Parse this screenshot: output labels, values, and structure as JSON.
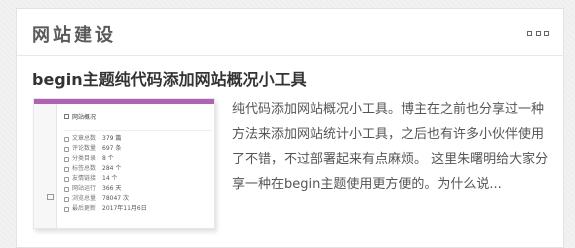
{
  "section": {
    "title": "网站建设",
    "more_icon": "more-dots-icon"
  },
  "post": {
    "title": "begin主题纯代码添加网站概况小工具",
    "excerpt": "纯代码添加网站概况小工具。博主在之前也分享过一种方法来添加网站统计小工具，之后也有许多小伙伴使用了不错，不过部署起来有点麻烦。 这里朱曙明给大家分享一种在begin主题使用更方便的。为什么说..."
  },
  "thumbnail": {
    "accent_color": "#b062b5",
    "panel_title": "网站概况",
    "rows": [
      {
        "icon": "doc-icon",
        "label": "文章总数",
        "value": "379 篇"
      },
      {
        "icon": "comment-icon",
        "label": "评论数量",
        "value": "697 条"
      },
      {
        "icon": "folder-icon",
        "label": "分类目录",
        "value": "8 个"
      },
      {
        "icon": "tag-icon",
        "label": "标签总数",
        "value": "284 个"
      },
      {
        "icon": "link-icon",
        "label": "友情链接",
        "value": "14 个"
      },
      {
        "icon": "clock-icon",
        "label": "网站运行",
        "value": "366 天"
      },
      {
        "icon": "eye-icon",
        "label": "浏览总量",
        "value": "78047 次"
      },
      {
        "icon": "update-icon",
        "label": "最后更新",
        "value": "2017年11月6日"
      }
    ]
  }
}
